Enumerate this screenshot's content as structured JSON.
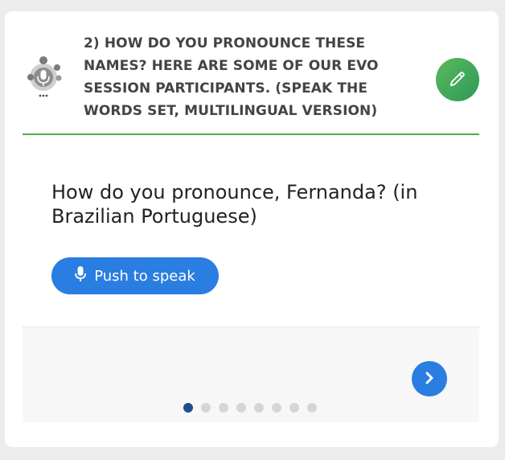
{
  "header": {
    "title": "2) How do you pronounce these names? Here are some of our EVO session participants. (Speak the words set, multilingual version)",
    "icon": "speech-quiz-icon",
    "edit_icon": "pencil-icon"
  },
  "question": {
    "text": "How do you pronounce, Fernanda? (in Brazilian Portuguese)"
  },
  "speak_button": {
    "label": "Push to speak",
    "icon": "microphone-icon"
  },
  "navigation": {
    "next_icon": "chevron-right-icon",
    "total_pages": 8,
    "current_page": 1
  },
  "colors": {
    "accent_blue": "#2a7de1",
    "green": "#4cae4c",
    "active_dot": "#1f4e8c"
  }
}
